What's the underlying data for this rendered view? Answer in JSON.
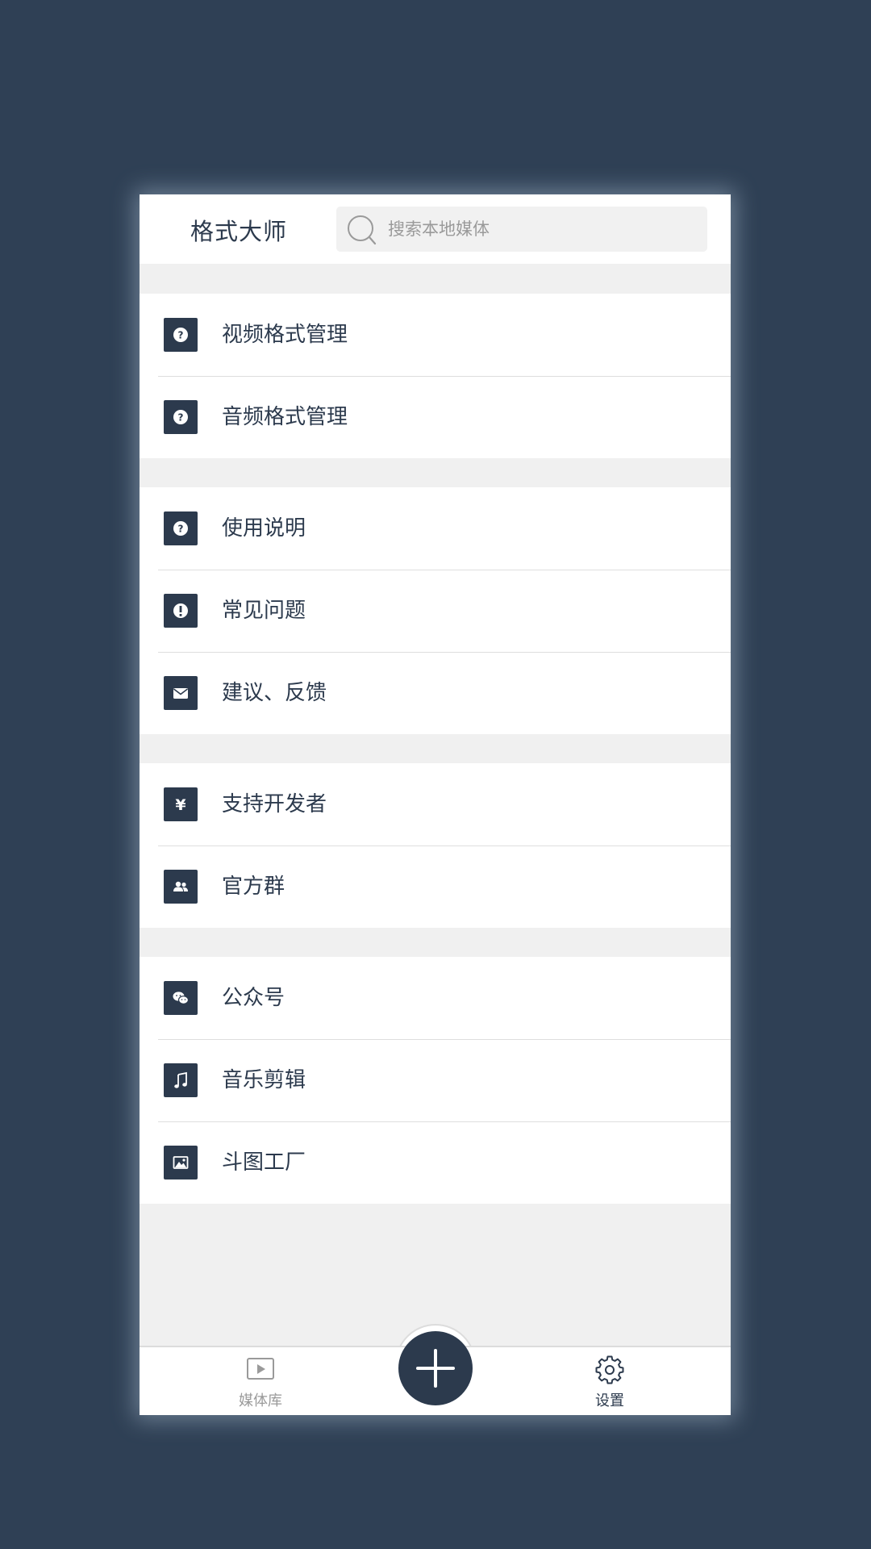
{
  "header": {
    "title": "格式大师",
    "search_placeholder": "搜索本地媒体",
    "search_value": ""
  },
  "groups": [
    {
      "items": [
        {
          "label": "视频格式管理",
          "icon": "question-circle-icon"
        },
        {
          "label": "音频格式管理",
          "icon": "question-circle-icon"
        }
      ]
    },
    {
      "items": [
        {
          "label": "使用说明",
          "icon": "question-circle-icon"
        },
        {
          "label": "常见问题",
          "icon": "exclamation-circle-icon"
        },
        {
          "label": "建议、反馈",
          "icon": "envelope-icon"
        }
      ]
    },
    {
      "items": [
        {
          "label": "支持开发者",
          "icon": "yen-icon"
        },
        {
          "label": "官方群",
          "icon": "users-icon"
        }
      ]
    },
    {
      "items": [
        {
          "label": "公众号",
          "icon": "wechat-icon"
        },
        {
          "label": "音乐剪辑",
          "icon": "music-note-icon"
        },
        {
          "label": "斗图工厂",
          "icon": "image-icon"
        }
      ]
    }
  ],
  "bottom_nav": {
    "media_label": "媒体库",
    "settings_label": "设置",
    "active": "settings"
  },
  "colors": {
    "background": "#2f4055",
    "accent": "#2c3a4d",
    "surface": "#ffffff",
    "separator": "#f0f0f0",
    "muted_text": "#9a9a9a"
  }
}
